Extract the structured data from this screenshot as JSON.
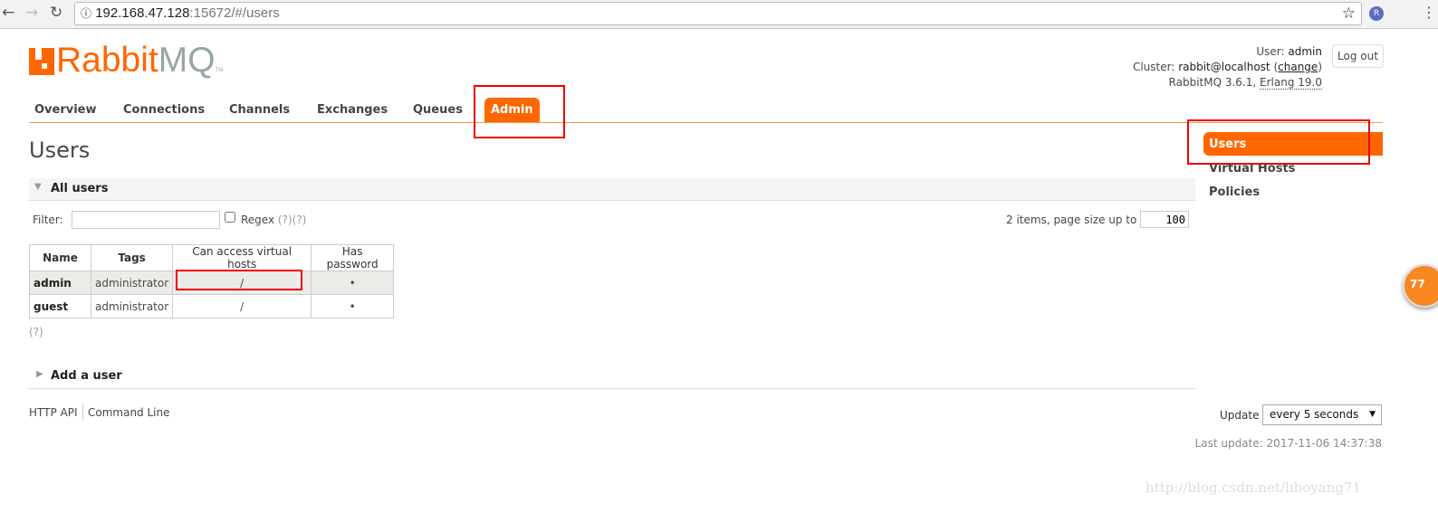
{
  "browser": {
    "url_host": "192.168.47.128",
    "url_rest": ":15672/#/users",
    "profile_initial": "R"
  },
  "logo": {
    "text_a": "Rabbit",
    "text_b": "MQ",
    "tm": "TM"
  },
  "header": {
    "user_label": "User:",
    "user": "admin",
    "cluster_label": "Cluster:",
    "cluster": "rabbit@localhost",
    "change": "change",
    "version": "RabbitMQ 3.6.1,",
    "erlang": "Erlang 19.0",
    "logout": "Log out"
  },
  "nav": [
    "Overview",
    "Connections",
    "Channels",
    "Exchanges",
    "Queues",
    "Admin"
  ],
  "page_title": "Users",
  "all_users": {
    "title": "All users",
    "filter_label": "Filter:",
    "filter_value": "",
    "regex": "Regex",
    "help1": "(?)",
    "help2": "(?)",
    "items_text": "2 items, page size up to",
    "page_size": "100",
    "columns": [
      "Name",
      "Tags",
      "Can access virtual hosts",
      "Has password"
    ],
    "rows": [
      {
        "name": "admin",
        "tags": "administrator",
        "vhosts": "/",
        "password": "•"
      },
      {
        "name": "guest",
        "tags": "administrator",
        "vhosts": "/",
        "password": "•"
      }
    ],
    "help": "(?)"
  },
  "add_user": "Add a user",
  "footer": {
    "http_api": "HTTP API",
    "command_line": "Command Line",
    "update_label": "Update",
    "update_value": "every 5 seconds",
    "last_update": "Last update: 2017-11-06 14:37:38"
  },
  "sidebar": [
    "Users",
    "Virtual Hosts",
    "Policies"
  ],
  "badge": "77",
  "watermark": "http://blog.csdn.net/liboyang71",
  "colors": {
    "accent": "#ff6600",
    "highlight": "#e00000"
  }
}
